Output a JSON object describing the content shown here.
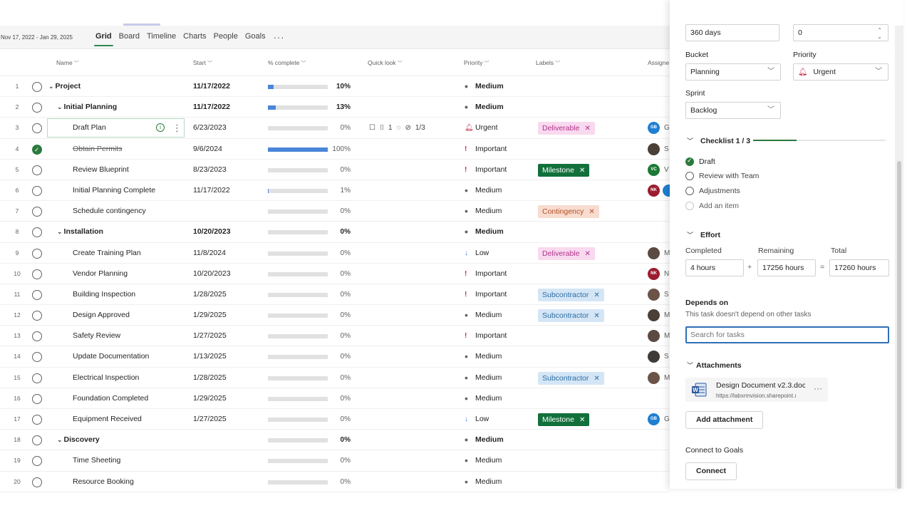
{
  "toolbar": {
    "date_range": "Nov 17, 2022 - Jan 29, 2025",
    "views": [
      "Grid",
      "Board",
      "Timeline",
      "Charts",
      "People",
      "Goals"
    ],
    "more": "···"
  },
  "columns": {
    "name": "Name",
    "start": "Start",
    "complete": "% complete",
    "quicklook": "Quick look",
    "priority": "Priority",
    "labels": "Labels",
    "assigned": "Assigne"
  },
  "rows": [
    {
      "num": "1",
      "name": "Project",
      "start": "11/17/2022",
      "pct": "10%",
      "progress": 10,
      "priority": "Medium"
    },
    {
      "num": "2",
      "name": "Initial Planning",
      "start": "11/17/2022",
      "pct": "13%",
      "progress": 13,
      "priority": "Medium"
    },
    {
      "num": "3",
      "name": "Draft Plan",
      "start": "6/23/2023",
      "pct": "0%",
      "progress": 0,
      "priority": "Urgent",
      "quicklook": {
        "attachments": "1",
        "checklist": "1/3"
      },
      "label": "Deliverable",
      "avatar": "GB",
      "avatar_rest": "G"
    },
    {
      "num": "4",
      "name": "Obtain Permits",
      "start": "9/6/2024",
      "pct": "100%",
      "progress": 100,
      "priority": "Important",
      "avatar_rest": "S"
    },
    {
      "num": "5",
      "name": "Review Blueprint",
      "start": "8/23/2023",
      "pct": "0%",
      "progress": 0,
      "priority": "Important",
      "label": "Milestone",
      "avatar": "VC",
      "avatar_rest": "V"
    },
    {
      "num": "6",
      "name": "Initial Planning Complete",
      "start": "11/17/2022",
      "pct": "1%",
      "progress": 1,
      "priority": "Medium",
      "avatar": "NK"
    },
    {
      "num": "7",
      "name": "Schedule contingency",
      "start": "",
      "pct": "0%",
      "progress": 0,
      "priority": "Medium",
      "label": "Contingency"
    },
    {
      "num": "8",
      "name": "Installation",
      "start": "10/20/2023",
      "pct": "0%",
      "progress": 0,
      "priority": "Medium"
    },
    {
      "num": "9",
      "name": "Create Training Plan",
      "start": "11/8/2024",
      "pct": "0%",
      "progress": 0,
      "priority": "Low",
      "label": "Deliverable",
      "avatar_rest": "M"
    },
    {
      "num": "10",
      "name": "Vendor Planning",
      "start": "10/20/2023",
      "pct": "0%",
      "progress": 0,
      "priority": "Important",
      "avatar": "NK",
      "avatar_rest": "N"
    },
    {
      "num": "11",
      "name": "Building Inspection",
      "start": "1/28/2025",
      "pct": "0%",
      "progress": 0,
      "priority": "Important",
      "label": "Subcontractor",
      "avatar_rest": "S"
    },
    {
      "num": "12",
      "name": "Design Approved",
      "start": "1/29/2025",
      "pct": "0%",
      "progress": 0,
      "priority": "Medium",
      "label": "Subcontractor",
      "avatar_rest": "M"
    },
    {
      "num": "13",
      "name": "Safety Review",
      "start": "1/27/2025",
      "pct": "0%",
      "progress": 0,
      "priority": "Important",
      "avatar_rest": "M"
    },
    {
      "num": "14",
      "name": "Update Documentation",
      "start": "1/13/2025",
      "pct": "0%",
      "progress": 0,
      "priority": "Medium",
      "avatar_rest": "S"
    },
    {
      "num": "15",
      "name": "Electrical Inspection",
      "start": "1/28/2025",
      "pct": "0%",
      "progress": 0,
      "priority": "Medium",
      "label": "Subcontractor",
      "avatar_rest": "M"
    },
    {
      "num": "16",
      "name": "Foundation Completed",
      "start": "1/29/2025",
      "pct": "0%",
      "progress": 0,
      "priority": "Medium"
    },
    {
      "num": "17",
      "name": "Equipment Received",
      "start": "1/27/2025",
      "pct": "0%",
      "progress": 0,
      "priority": "Low",
      "label": "Milestone",
      "avatar": "GB",
      "avatar_rest": "G"
    },
    {
      "num": "18",
      "name": "Discovery",
      "start": "",
      "pct": "0%",
      "progress": 0,
      "priority": "Medium"
    },
    {
      "num": "19",
      "name": "Time Sheeting",
      "start": "",
      "pct": "0%",
      "progress": 0,
      "priority": "Medium"
    },
    {
      "num": "20",
      "name": "Resource Booking",
      "start": "",
      "pct": "0%",
      "progress": 0,
      "priority": "Medium"
    }
  ],
  "panel": {
    "duration_value": "360 days",
    "number_value": "0",
    "bucket_label": "Bucket",
    "bucket_value": "Planning",
    "priority_label": "Priority",
    "priority_value": "Urgent",
    "sprint_label": "Sprint",
    "sprint_value": "Backlog",
    "checklist_title": "Checklist 1 / 3",
    "checklist_progress": 0.33,
    "checklist_items": [
      "Draft",
      "Review with Team",
      "Adjustments"
    ],
    "add_item": "Add an item",
    "effort_title": "Effort",
    "completed_label": "Completed",
    "remaining_label": "Remaining",
    "total_label": "Total",
    "completed_value": "4 hours",
    "remaining_value": "17256 hours",
    "total_value": "17260 hours",
    "plus": "+",
    "equals": "=",
    "depends_title": "Depends on",
    "depends_desc": "This task doesn't depend on other tasks",
    "search_placeholder": "Search for tasks",
    "attachments_title": "Attachments",
    "attachment_name": "Design Document v2.3.docı",
    "attachment_url": "https://labxrmvision.sharepoint.ı",
    "attachment_more": "···",
    "add_attachment": "Add attachment",
    "goals_title": "Connect to Goals",
    "connect": "Connect"
  },
  "colors": {
    "accent_green": "#2b7a3c",
    "progress_blue": "#4a86d8",
    "deliverable_bg": "#f9d9ef",
    "deliverable_fg": "#b0348b",
    "milestone_bg": "#12703b",
    "milestone_fg": "#ffffff",
    "contingency_bg": "#f8dccf",
    "contingency_fg": "#b4502a",
    "subcontractor_bg": "#d4e6f6",
    "subcontractor_fg": "#2e6da4"
  }
}
